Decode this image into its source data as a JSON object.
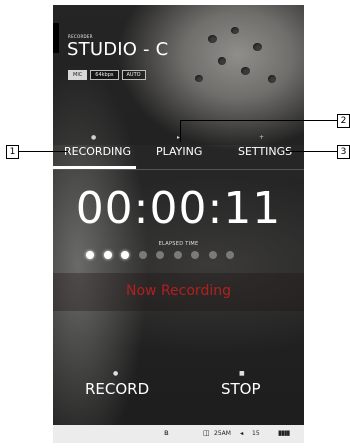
{
  "app": {
    "section_label": "RECORDER",
    "title": "STUDIO - C",
    "badges": [
      {
        "label": "MIC",
        "active": true
      },
      {
        "label": "64kbps",
        "active": false
      },
      {
        "label": "AUTO",
        "active": false
      }
    ]
  },
  "tabs": [
    {
      "label": "RECORDING",
      "icon": "dot-icon",
      "active": true
    },
    {
      "label": "PLAYING",
      "icon": "play-icon",
      "active": false
    },
    {
      "label": "SETTINGS",
      "icon": "plus-icon",
      "active": false
    }
  ],
  "timer": {
    "value": "00:00:11",
    "label": "ELAPSED TIME",
    "progress_dots_total": 9,
    "progress_dots_active": 3
  },
  "status_text": "Now Recording",
  "controls": {
    "record_label": "RECORD",
    "stop_label": "STOP"
  },
  "status_bar": {
    "bluetooth": "bluetooth-icon",
    "time": "25AM",
    "volume": "15",
    "volume_icon": "speaker-icon",
    "battery_icon": "battery-icon"
  },
  "callouts": [
    "1",
    "2",
    "3"
  ],
  "colors": {
    "accent_red": "#b31f1f",
    "text_white": "#ffffff",
    "statusbar_bg": "#ececec"
  }
}
